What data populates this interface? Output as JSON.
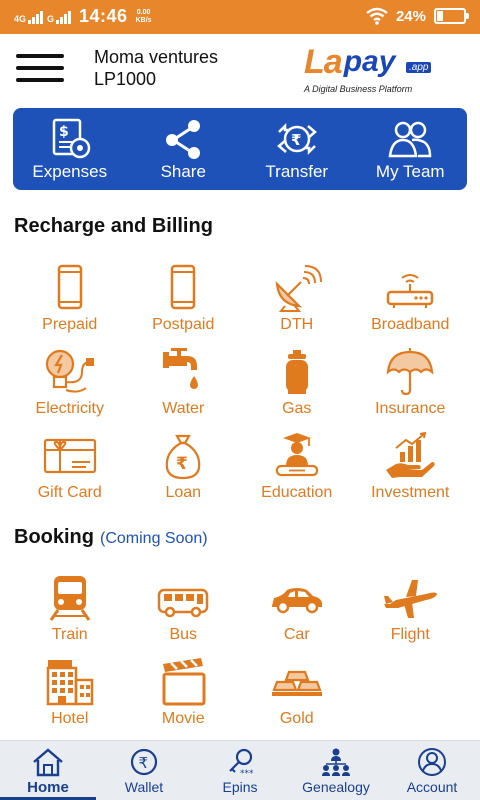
{
  "status_bar": {
    "network_1": "4G",
    "network_2": "G",
    "time": "14:46",
    "speed_value": "0.00",
    "speed_unit": "KB/s",
    "battery_percent": "24%",
    "battery_level": 0.24
  },
  "header": {
    "account_name": "Moma ventures",
    "account_id": "LP1000",
    "logo_la": "La",
    "logo_pay": "pay",
    "logo_app": ".app",
    "logo_tagline": "A Digital Business Platform"
  },
  "quick_actions": [
    {
      "label": "Expenses",
      "icon": "expenses-icon"
    },
    {
      "label": "Share",
      "icon": "share-icon"
    },
    {
      "label": "Transfer",
      "icon": "rupee-transfer-icon"
    },
    {
      "label": "My Team",
      "icon": "team-icon"
    }
  ],
  "recharge": {
    "title": "Recharge and Billing",
    "items": [
      {
        "label": "Prepaid",
        "icon": "mobile-icon"
      },
      {
        "label": "Postpaid",
        "icon": "mobile-icon"
      },
      {
        "label": "DTH",
        "icon": "satellite-dish-icon"
      },
      {
        "label": "Broadband",
        "icon": "router-icon"
      },
      {
        "label": "Electricity",
        "icon": "bulb-plug-icon"
      },
      {
        "label": "Water",
        "icon": "water-tap-icon"
      },
      {
        "label": "Gas",
        "icon": "gas-cylinder-icon"
      },
      {
        "label": "Insurance",
        "icon": "umbrella-icon"
      },
      {
        "label": "Gift Card",
        "icon": "gift-card-icon"
      },
      {
        "label": "Loan",
        "icon": "rupee-bag-icon"
      },
      {
        "label": "Education",
        "icon": "graduation-icon"
      },
      {
        "label": "Investment",
        "icon": "investment-hand-icon"
      }
    ]
  },
  "booking": {
    "title": "Booking",
    "note": "(Coming Soon)",
    "items": [
      {
        "label": "Train",
        "icon": "train-icon"
      },
      {
        "label": "Bus",
        "icon": "bus-icon"
      },
      {
        "label": "Car",
        "icon": "car-icon"
      },
      {
        "label": "Flight",
        "icon": "airplane-icon"
      },
      {
        "label": "Hotel",
        "icon": "hotel-icon"
      },
      {
        "label": "Movie",
        "icon": "clapperboard-icon"
      },
      {
        "label": "Gold",
        "icon": "gold-bars-icon"
      }
    ]
  },
  "bottom_nav": [
    {
      "label": "Home",
      "icon": "home-icon",
      "active": true
    },
    {
      "label": "Wallet",
      "icon": "rupee-wallet-icon",
      "active": false
    },
    {
      "label": "Epins",
      "icon": "key-pin-icon",
      "active": false
    },
    {
      "label": "Genealogy",
      "icon": "genealogy-icon",
      "active": false
    },
    {
      "label": "Account",
      "icon": "account-icon",
      "active": false
    }
  ],
  "colors": {
    "accent_orange": "#e8862b",
    "brand_blue": "#1e52b9",
    "nav_text": "#1a3f8f",
    "nav_bg": "#e9edf2"
  }
}
